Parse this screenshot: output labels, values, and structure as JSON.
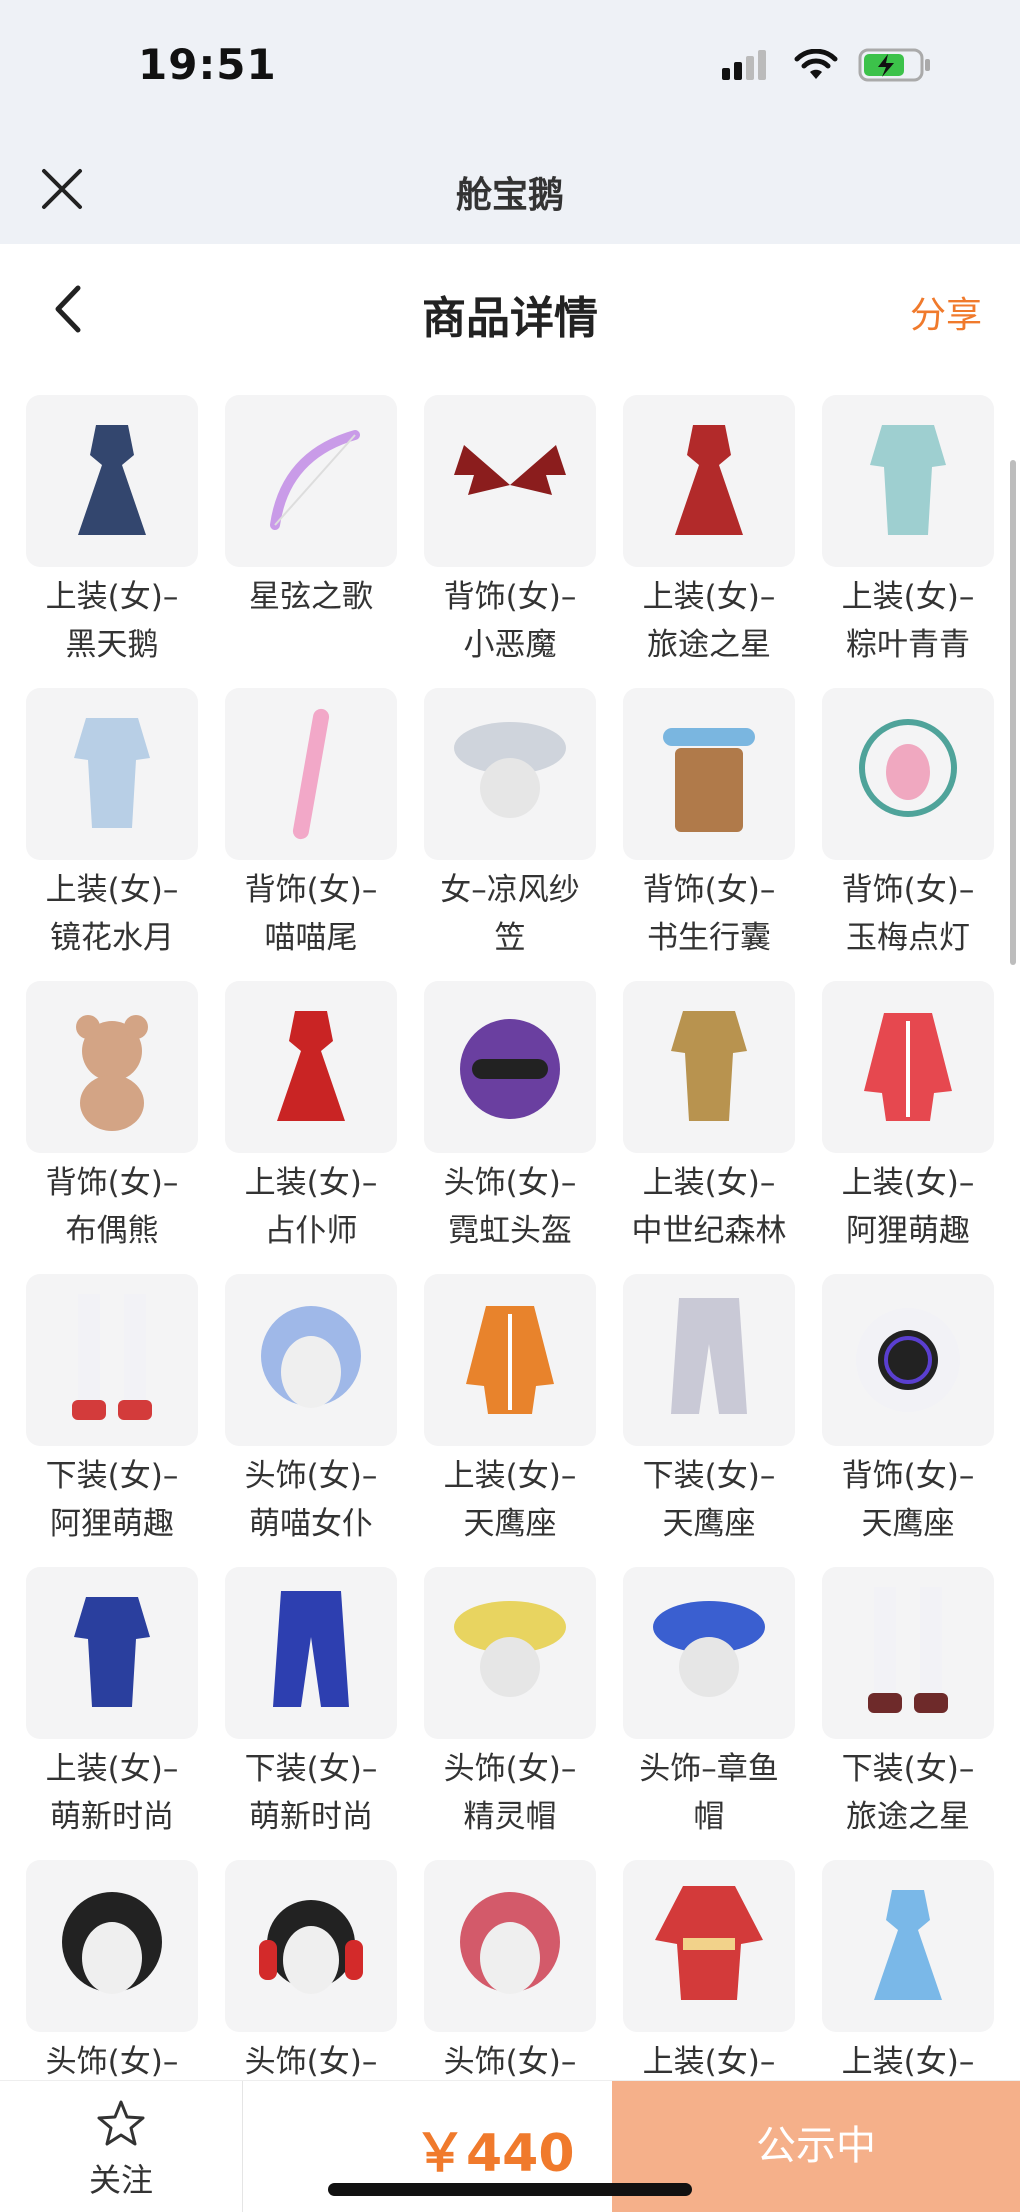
{
  "status": {
    "time": "19:51"
  },
  "app": {
    "title": "舱宝鹅"
  },
  "nav": {
    "title": "商品详情",
    "share": "分享"
  },
  "items": [
    {
      "label": "上装(女)–\n黑天鹅",
      "icon": "dress-icon",
      "color": "#33466e"
    },
    {
      "label": "星弦之歌",
      "icon": "bow-icon",
      "color": "#c99be8"
    },
    {
      "label": "背饰(女)–\n小恶魔",
      "icon": "wings-icon",
      "color": "#8b1d1d"
    },
    {
      "label": "上装(女)–\n旅途之星",
      "icon": "dress-icon",
      "color": "#b22a2a"
    },
    {
      "label": "上装(女)–\n粽叶青青",
      "icon": "outfit-icon",
      "color": "#9ecfd0"
    },
    {
      "label": "上装(女)–\n镜花水月",
      "icon": "outfit-icon",
      "color": "#b8cfe6"
    },
    {
      "label": "背饰(女)–\n喵喵尾",
      "icon": "tail-icon",
      "color": "#f2a8c8"
    },
    {
      "label": "女–凉风纱\n笠",
      "icon": "hat-icon",
      "color": "#cfd4dc"
    },
    {
      "label": "背饰(女)–\n书生行囊",
      "icon": "backpack-icon",
      "color": "#b07a4a"
    },
    {
      "label": "背饰(女)–\n玉梅点灯",
      "icon": "lantern-icon",
      "color": "#4fa39a"
    },
    {
      "label": "背饰(女)–\n布偶熊",
      "icon": "bear-icon",
      "color": "#d3a485"
    },
    {
      "label": "上装(女)–\n占仆师",
      "icon": "dress-icon",
      "color": "#c92424"
    },
    {
      "label": "头饰(女)–\n霓虹头盔",
      "icon": "helmet-icon",
      "color": "#6a3fa0"
    },
    {
      "label": "上装(女)–\n中世纪森林",
      "icon": "outfit-icon",
      "color": "#b8934f"
    },
    {
      "label": "上装(女)–\n阿狸萌趣",
      "icon": "jacket-icon",
      "color": "#e6484f"
    },
    {
      "label": "下装(女)–\n阿狸萌趣",
      "icon": "boots-icon",
      "color": "#d33b3b"
    },
    {
      "label": "头饰(女)–\n萌喵女仆",
      "icon": "hair-icon",
      "color": "#9fb8e8"
    },
    {
      "label": "上装(女)–\n天鹰座",
      "icon": "jacket-icon",
      "color": "#e8832c"
    },
    {
      "label": "下装(女)–\n天鹰座",
      "icon": "pants-icon",
      "color": "#c9c9d6"
    },
    {
      "label": "背饰(女)–\n天鹰座",
      "icon": "device-icon",
      "color": "#5a3fd0"
    },
    {
      "label": "上装(女)–\n萌新时尚",
      "icon": "outfit-icon",
      "color": "#2a3f9e"
    },
    {
      "label": "下装(女)–\n萌新时尚",
      "icon": "pants-icon",
      "color": "#2d3fb0"
    },
    {
      "label": "头饰(女)–\n精灵帽",
      "icon": "hat-icon",
      "color": "#e8d460"
    },
    {
      "label": "头饰–章鱼\n帽",
      "icon": "hat-icon",
      "color": "#3a5fd0"
    },
    {
      "label": "下装(女)–\n旅途之星",
      "icon": "boots-icon",
      "color": "#6e2a2a"
    },
    {
      "label": "头饰(女)–",
      "icon": "hair-icon",
      "color": "#222222"
    },
    {
      "label": "头饰(女)–",
      "icon": "headphones-icon",
      "color": "#d32a2a"
    },
    {
      "label": "头饰(女)–",
      "icon": "hair-icon",
      "color": "#d35a6a"
    },
    {
      "label": "上装(女)–",
      "icon": "kimono-icon",
      "color": "#d33a3a"
    },
    {
      "label": "上装(女)–",
      "icon": "dress-icon",
      "color": "#7ab8e8"
    }
  ],
  "bottom": {
    "follow": "关注",
    "price": "￥440",
    "status": "公示中"
  },
  "colors": {
    "accent": "#f07a2c",
    "button": "#f5b08a"
  }
}
